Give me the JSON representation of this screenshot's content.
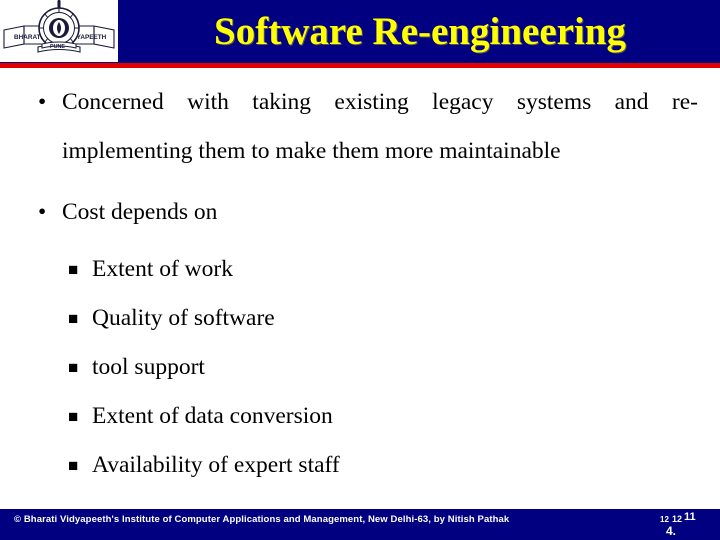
{
  "slide": {
    "title": "Software Re-engineering",
    "title_color": "#FFFF00",
    "header_bg": "#000080",
    "header_rule_color": "#E00000",
    "body_bg": "#FFFFFF",
    "text_color": "#000000"
  },
  "logo": {
    "name": "bharati-vidyapeeth-logo",
    "left_banner_text": "BHARATI",
    "right_banner_text": "VIDYAPEETH",
    "scroll_text": "PUNE"
  },
  "bullets": [
    {
      "marker": "•",
      "text": "Concerned with taking existing legacy systems and re-implementing them to make them more maintainable",
      "level": 1
    },
    {
      "marker": "•",
      "text": "Cost depends on",
      "level": 1
    }
  ],
  "sub_bullets": [
    {
      "marker": "§",
      "text": "Extent of work",
      "level": 2
    },
    {
      "marker": "§",
      "text": "Quality of software",
      "level": 2
    },
    {
      "marker": "§",
      "text": "tool support",
      "level": 2
    },
    {
      "marker": "§",
      "text": "Extent of data conversion",
      "level": 2
    },
    {
      "marker": "§",
      "text": "Availability of expert staff",
      "level": 2
    }
  ],
  "footer": {
    "bg": "#000080",
    "text": "© Bharati Vidyapeeth's Institute of Computer Applications and Management, New Delhi-63, by  Nitish Pathak",
    "page_number_parts": {
      "a": "12",
      "b": "12",
      "c": "11",
      "d": "4."
    }
  }
}
